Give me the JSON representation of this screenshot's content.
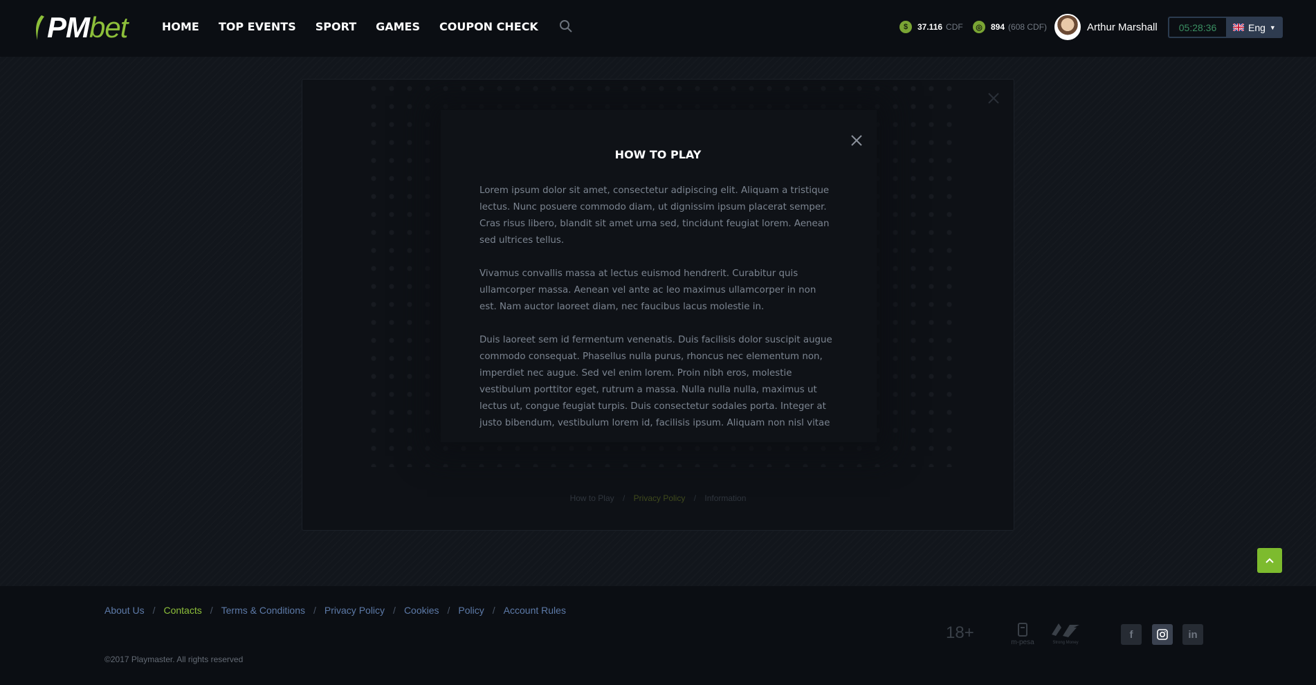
{
  "header": {
    "logo": {
      "part1": "PM",
      "part2": "bet"
    },
    "nav": [
      "HOME",
      "TOP EVENTS",
      "SPORT",
      "GAMES",
      "COUPON CHECK"
    ],
    "balance_main": {
      "value": "37.116",
      "currency": "CDF"
    },
    "balance_bonus": {
      "value": "894",
      "currency": "(608 CDF)"
    },
    "user_name": "Arthur Marshall",
    "clock": "05:28:36",
    "language": "Eng"
  },
  "modal": {
    "title": "HOW TO PLAY",
    "paragraphs": [
      "Lorem ipsum dolor sit amet, consectetur adipiscing elit. Aliquam a tristique lectus. Nunc posuere commodo diam, ut dignissim ipsum placerat semper. Cras risus libero, blandit sit amet urna sed, tincidunt feugiat lorem. Aenean sed ultrices tellus.",
      "Vivamus convallis massa at lectus euismod hendrerit. Curabitur quis ullamcorper massa. Aenean vel ante ac leo maximus ullamcorper in non est. Nam auctor laoreet diam, nec faucibus lacus molestie in.",
      "Duis laoreet sem id fermentum venenatis. Duis facilisis dolor suscipit augue commodo consequat. Phasellus nulla purus, rhoncus nec elementum non, imperdiet nec augue. Sed vel enim lorem. Proin nibh eros, molestie vestibulum porttitor eget, rutrum a massa. Nulla nulla nulla, maximus ut lectus ut, congue feugiat turpis. Duis consectetur sodales porta. Integer at justo bibendum, vestibulum lorem id, facilisis ipsum. Aliquam non nisl vitae"
    ],
    "links": [
      "How to Play",
      "Privacy Policy",
      "Information"
    ],
    "links_sep": "/"
  },
  "footer": {
    "links": [
      "About Us",
      "Contacts",
      "Terms & Conditions",
      "Privacy Policy",
      "Cookies",
      "Policy",
      "Account Rules"
    ],
    "links_sep": "/",
    "copyright": "©2017 Playmaster. All rights reserved",
    "age": "18+",
    "mpesa_label": "m-pesa",
    "strongmoney_label": "Strong Money",
    "social": [
      "f",
      "in"
    ]
  },
  "colors": {
    "accent": "#8dbf3a",
    "background": "#12161c",
    "header_bg": "#0b0e13",
    "link_blue": "#5d7aa8"
  },
  "icons": [
    "search-icon",
    "coin-icon",
    "bonus-coin-icon",
    "avatar",
    "uk-flag-icon",
    "chevron-down-icon",
    "close-icon",
    "chevron-up-icon",
    "facebook-icon",
    "instagram-icon",
    "linkedin-icon",
    "mpesa-logo",
    "strong-money-logo"
  ]
}
